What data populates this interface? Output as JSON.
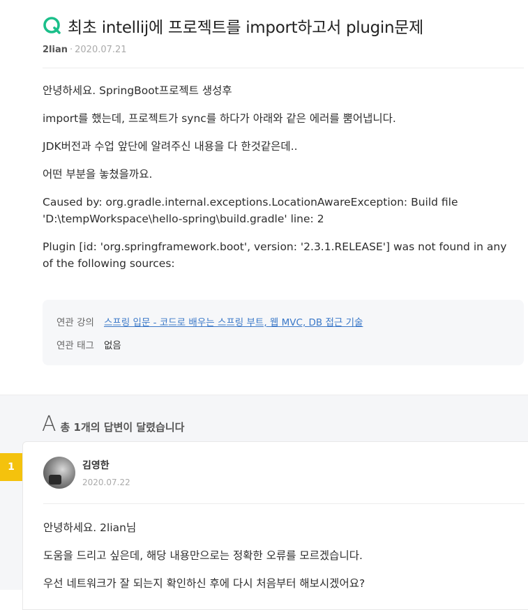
{
  "question": {
    "title": "최초 intellij에 프로젝트를 import하고서 plugin문제",
    "author": "2lian",
    "separator": "·",
    "date": "2020.07.21",
    "body": [
      "안녕하세요. SpringBoot프로젝트 생성후",
      "import를 했는데, 프로젝트가 sync를 하다가 아래와 같은 에러를 뿜어냅니다.",
      "JDK버전과 수업 앞단에 알려주신 내용을 다 한것같은데..",
      "어떤 부분을 놓쳤을까요.",
      "Caused by: org.gradle.internal.exceptions.LocationAwareException: Build file 'D:\\tempWorkspace\\hello-spring\\build.gradle' line: 2",
      "Plugin [id: 'org.springframework.boot', version: '2.3.1.RELEASE'] was not found in any of the following sources:"
    ],
    "info": {
      "course_label": "연관 강의",
      "course_link": "스프링 입문 - 코드로 배우는 스프링 부트, 웹 MVC, DB 접근 기술",
      "tag_label": "연관 태그",
      "tag_value": "없음"
    }
  },
  "answers": {
    "header_letter": "A",
    "count_text": "총 1개의 답변이 달렸습니다",
    "items": [
      {
        "index": "1",
        "author": "김영한",
        "date": "2020.07.22",
        "body": [
          "안녕하세요. 2lian님",
          "도움을 드리고 싶은데, 해당 내용만으로는 정확한 오류를 모르겠습니다.",
          "우선 네트워크가 잘 되는지 확인하신 후에 다시 처음부터 해보시겠어요?"
        ]
      }
    ]
  },
  "colors": {
    "accent": "#1bbf8a",
    "badge": "#f4c20d",
    "link": "#3a78c8"
  },
  "icons": {
    "question_mark": "q-logo-icon"
  }
}
